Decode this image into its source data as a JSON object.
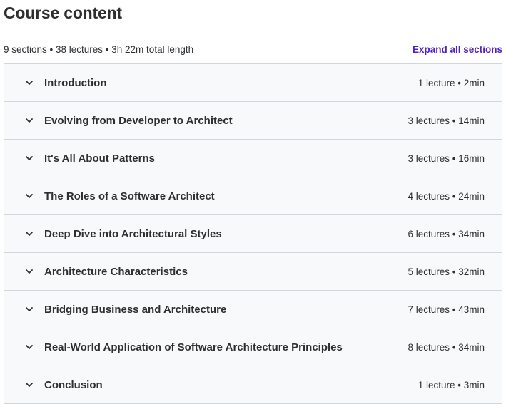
{
  "header": {
    "title": "Course content",
    "summary": "9 sections • 38 lectures • 3h 22m total length",
    "expand_all_label": "Expand all sections"
  },
  "colors": {
    "accent": "#5022c3",
    "text": "#2d2f31",
    "border": "#d1d7dc",
    "section_bg": "#f7f9fa"
  },
  "sections": [
    {
      "title": "Introduction",
      "meta": "1 lecture • 2min",
      "icon": "chevron-down-icon"
    },
    {
      "title": "Evolving from Developer to Architect",
      "meta": "3 lectures • 14min",
      "icon": "chevron-down-icon"
    },
    {
      "title": "It's All About Patterns",
      "meta": "3 lectures • 16min",
      "icon": "chevron-down-icon"
    },
    {
      "title": "The Roles of a Software Architect",
      "meta": "4 lectures • 24min",
      "icon": "chevron-down-icon"
    },
    {
      "title": "Deep Dive into Architectural Styles",
      "meta": "6 lectures • 34min",
      "icon": "chevron-down-icon"
    },
    {
      "title": "Architecture Characteristics",
      "meta": "5 lectures • 32min",
      "icon": "chevron-down-icon"
    },
    {
      "title": "Bridging Business and Architecture",
      "meta": "7 lectures • 43min",
      "icon": "chevron-down-icon"
    },
    {
      "title": "Real-World Application of Software Architecture Principles",
      "meta": "8 lectures • 34min",
      "icon": "chevron-down-icon"
    },
    {
      "title": "Conclusion",
      "meta": "1 lecture • 3min",
      "icon": "chevron-down-icon"
    }
  ]
}
